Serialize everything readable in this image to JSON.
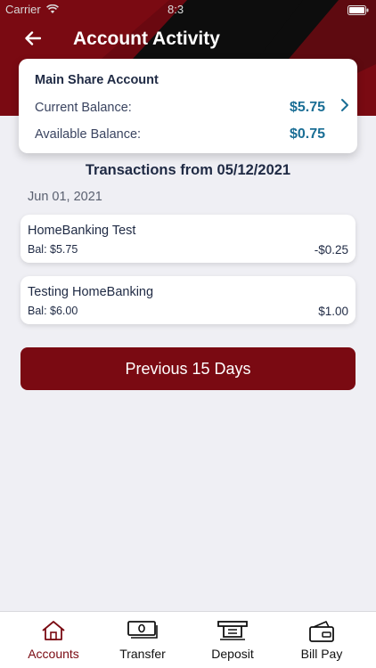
{
  "status_bar": {
    "carrier": "Carrier",
    "time": "8:3"
  },
  "header": {
    "title": "Account Activity",
    "back_icon": "arrow-left-icon"
  },
  "account": {
    "name": "Main Share Account",
    "current_label": "Current Balance:",
    "current_value": "$5.75",
    "available_label": "Available Balance:",
    "available_value": "$0.75"
  },
  "transactions": {
    "heading": "Transactions from 05/12/2021",
    "date_group": "Jun 01, 2021",
    "items": [
      {
        "description": "HomeBanking Test",
        "balance": "Bal: $5.75",
        "amount": "-$0.25"
      },
      {
        "description": "Testing HomeBanking",
        "balance": "Bal: $6.00",
        "amount": "$1.00"
      }
    ],
    "more_button": "Previous 15 Days"
  },
  "tabs": [
    {
      "label": "Accounts",
      "icon": "home-icon",
      "active": true
    },
    {
      "label": "Transfer",
      "icon": "cash-icon",
      "active": false
    },
    {
      "label": "Deposit",
      "icon": "check-deposit-icon",
      "active": false
    },
    {
      "label": "Bill Pay",
      "icon": "wallet-card-icon",
      "active": false
    }
  ],
  "colors": {
    "brand": "#7a0a12",
    "header_dark": "#0d0d0d",
    "balance_value": "#1a6e95",
    "background": "#efeff4"
  }
}
